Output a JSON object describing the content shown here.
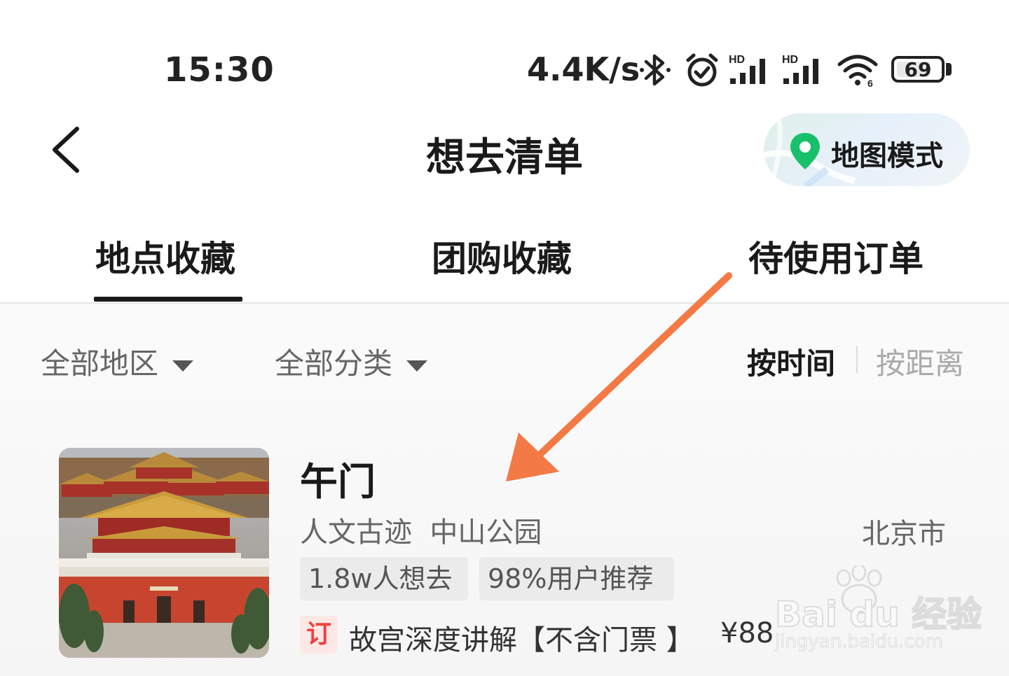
{
  "status_bar": {
    "time": "15:30",
    "net_speed": "4.4K/s",
    "battery": "69",
    "icons": [
      "bluetooth-icon",
      "alarm-icon",
      "signal-hd-icon",
      "signal-hd-icon",
      "wifi-icon",
      "battery-icon"
    ]
  },
  "header": {
    "back_icon": "chevron-left-icon",
    "title": "想去清单",
    "map_button": {
      "label": "地图模式",
      "icon": "map-pin-icon",
      "accent": "#19c06b"
    }
  },
  "tabs": [
    {
      "label": "地点收藏",
      "active": true
    },
    {
      "label": "团购收藏",
      "active": false
    },
    {
      "label": "待使用订单",
      "active": false
    }
  ],
  "filters": {
    "region": "全部地区",
    "category": "全部分类",
    "sort_options": [
      "按时间",
      "按距离"
    ],
    "sort_active": "按时间"
  },
  "list": [
    {
      "name": "午门",
      "categories": "人文古迹  中山公园",
      "city": "北京市",
      "tags": [
        "1.8w人想去",
        "98%用户推荐"
      ],
      "deal": {
        "badge": "订",
        "title": "故宫深度讲解【不含门票 】",
        "price": "¥88"
      }
    }
  ],
  "watermark": {
    "brand": "Bai du 经验",
    "url": "jingyan.baidu.com"
  },
  "annotation": {
    "type": "arrow",
    "color": "#f47a45"
  },
  "colors": {
    "accent_red": "#f0413c",
    "text_primary": "#1a1a1a",
    "text_secondary": "#666666"
  }
}
